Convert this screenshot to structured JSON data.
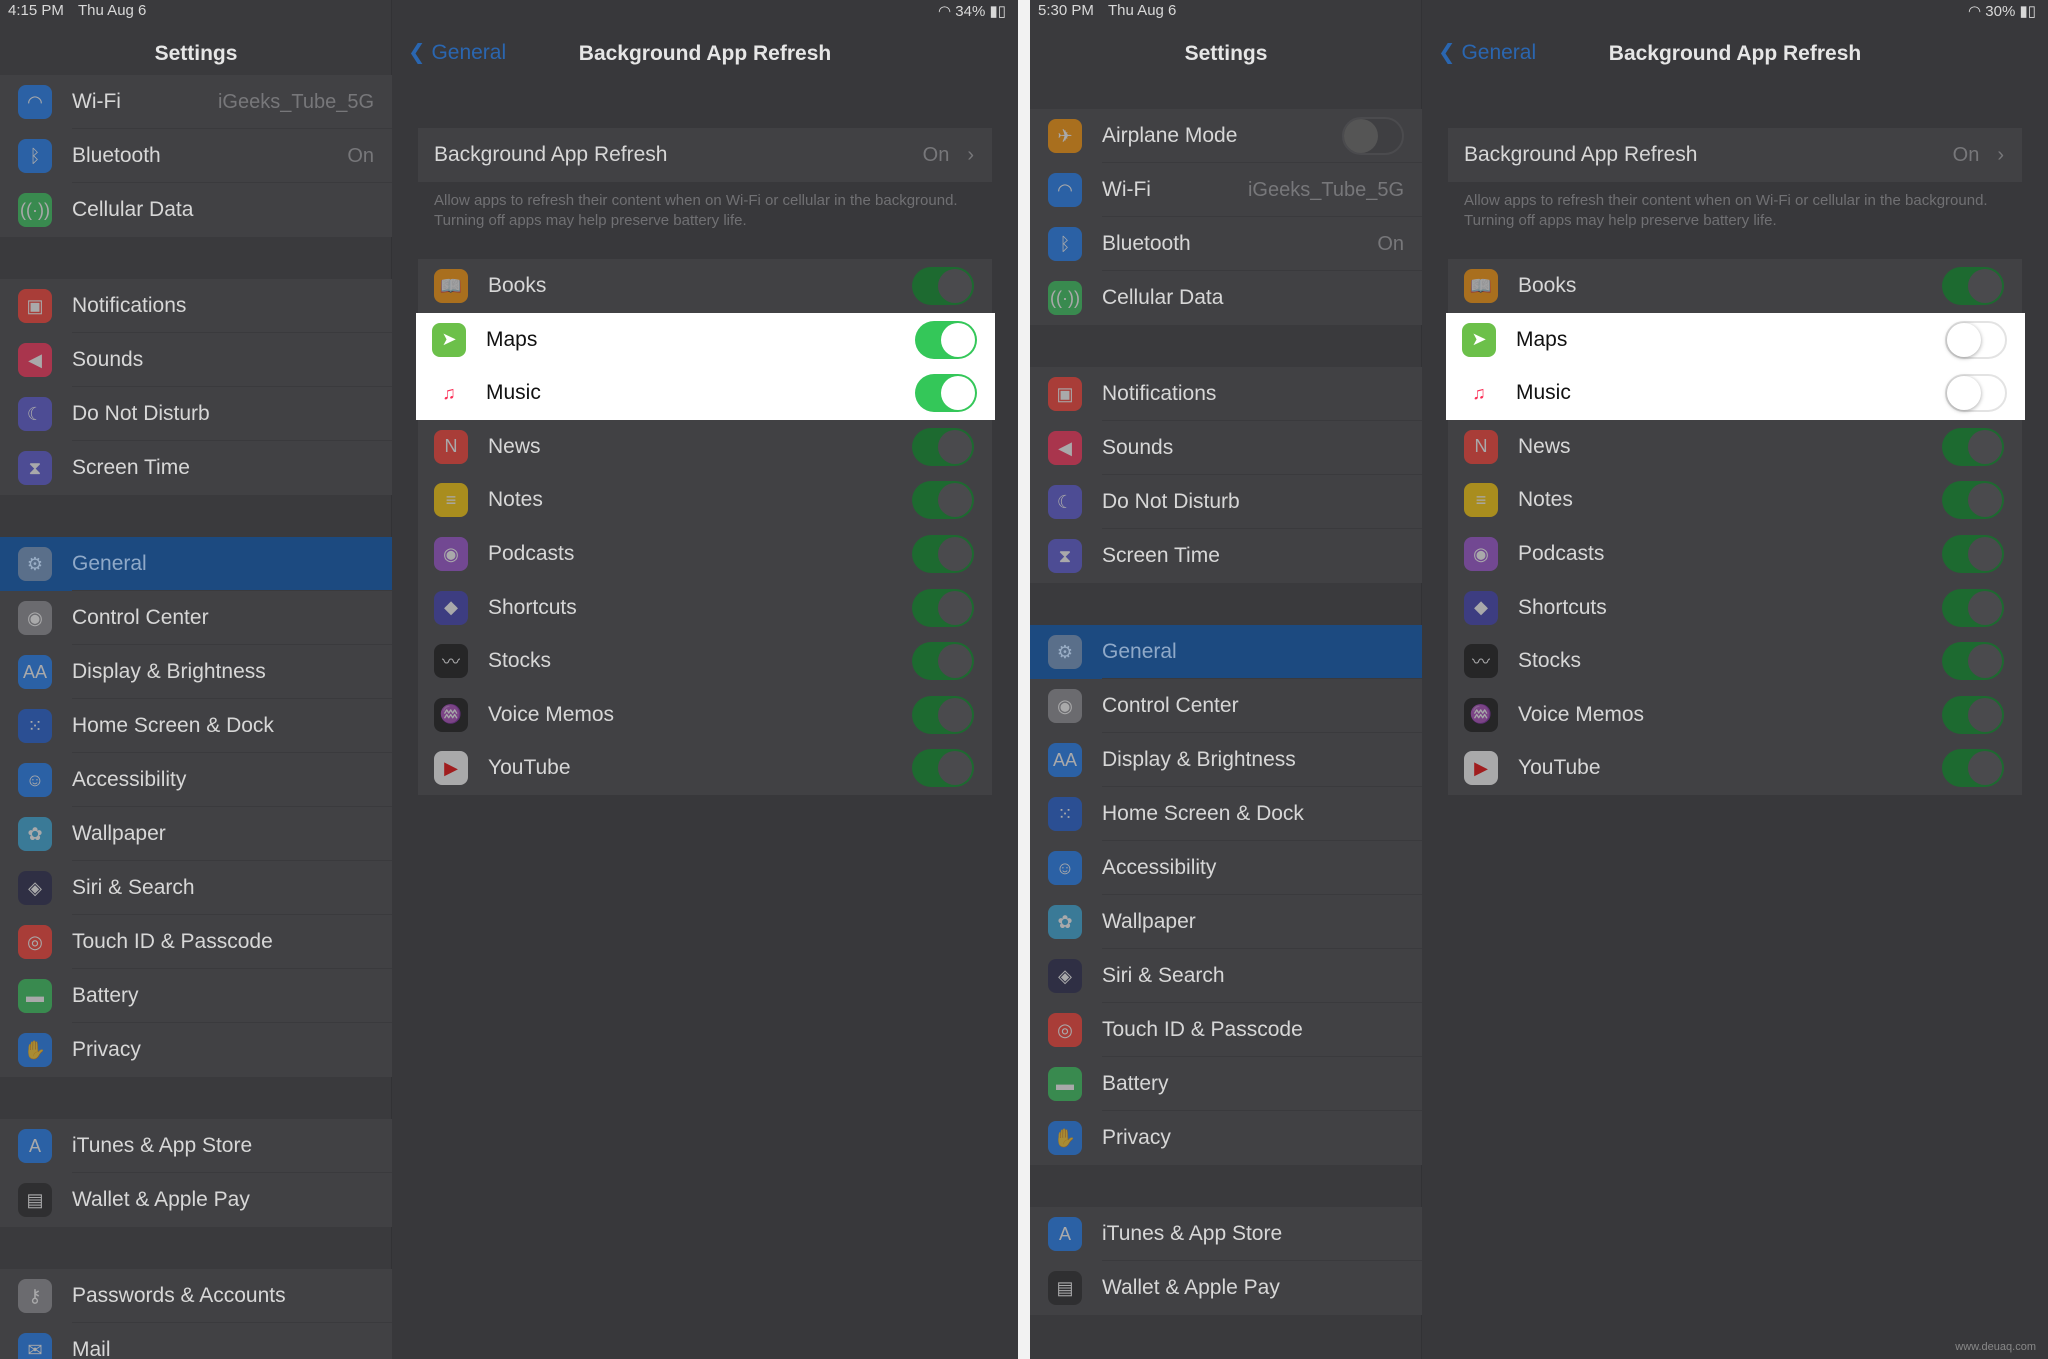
{
  "screens": [
    {
      "status": {
        "time": "4:15 PM",
        "date": "Thu Aug 6",
        "battery": "34%"
      },
      "sidebar": {
        "title": "Settings",
        "selected": "General",
        "groups": [
          [
            {
              "label": "Wi-Fi",
              "value": "iGeeks_Tube_5G",
              "icon": "wifi-icon",
              "color": "#1a7cf5",
              "glyph": "◠"
            },
            {
              "label": "Bluetooth",
              "value": "On",
              "icon": "bluetooth-icon",
              "color": "#1a7cf5",
              "glyph": "ᛒ"
            },
            {
              "label": "Cellular Data",
              "icon": "cellular-icon",
              "color": "#34c759",
              "glyph": "((·))"
            }
          ],
          [
            {
              "label": "Notifications",
              "icon": "notifications-icon",
              "color": "#ff3b30",
              "glyph": "▣"
            },
            {
              "label": "Sounds",
              "icon": "sounds-icon",
              "color": "#ff2d55",
              "glyph": "◀"
            },
            {
              "label": "Do Not Disturb",
              "icon": "moon-icon",
              "color": "#5856d6",
              "glyph": "☾"
            },
            {
              "label": "Screen Time",
              "icon": "hourglass-icon",
              "color": "#5856d6",
              "glyph": "⧗"
            }
          ],
          [
            {
              "label": "General",
              "icon": "gear-icon",
              "color": "#8e8e93",
              "glyph": "⚙"
            },
            {
              "label": "Control Center",
              "icon": "control-center-icon",
              "color": "#8e8e93",
              "glyph": "◉"
            },
            {
              "label": "Display & Brightness",
              "icon": "display-icon",
              "color": "#1a7cf5",
              "glyph": "AA"
            },
            {
              "label": "Home Screen & Dock",
              "icon": "home-screen-icon",
              "color": "#1a5cd5",
              "glyph": "⁙"
            },
            {
              "label": "Accessibility",
              "icon": "accessibility-icon",
              "color": "#1a7cf5",
              "glyph": "☺"
            },
            {
              "label": "Wallpaper",
              "icon": "wallpaper-icon",
              "color": "#35aadc",
              "glyph": "✿"
            },
            {
              "label": "Siri & Search",
              "icon": "siri-icon",
              "color": "#222244",
              "glyph": "◈"
            },
            {
              "label": "Touch ID & Passcode",
              "icon": "fingerprint-icon",
              "color": "#ff3b30",
              "glyph": "◎"
            },
            {
              "label": "Battery",
              "icon": "battery-icon",
              "color": "#34c759",
              "glyph": "▬"
            },
            {
              "label": "Privacy",
              "icon": "hand-icon",
              "color": "#1a7cf5",
              "glyph": "✋"
            }
          ],
          [
            {
              "label": "iTunes & App Store",
              "icon": "app-store-icon",
              "color": "#1a7cf5",
              "glyph": "A"
            },
            {
              "label": "Wallet & Apple Pay",
              "icon": "wallet-icon",
              "color": "#222",
              "glyph": "▤"
            }
          ],
          [
            {
              "label": "Passwords & Accounts",
              "icon": "key-icon",
              "color": "#8e8e93",
              "glyph": "⚷"
            },
            {
              "label": "Mail",
              "icon": "mail-icon",
              "color": "#1a7cf5",
              "glyph": "✉"
            }
          ]
        ]
      },
      "detail": {
        "back": "General",
        "title": "Background App Refresh",
        "main": {
          "label": "Background App Refresh",
          "value": "On"
        },
        "description": "Allow apps to refresh their content when on Wi-Fi or cellular in the background. Turning off apps may help preserve battery life.",
        "apps": [
          {
            "label": "Books",
            "on": true,
            "icon": "books-icon",
            "color": "#ff9500",
            "glyph": "📖"
          },
          {
            "label": "Maps",
            "on": true,
            "highlight": true,
            "icon": "maps-icon",
            "color": "#6cc04a",
            "glyph": "➤"
          },
          {
            "label": "Music",
            "on": true,
            "highlight": true,
            "icon": "music-icon",
            "color": "#ffffff",
            "glyph": "♫"
          },
          {
            "label": "News",
            "on": true,
            "icon": "news-icon",
            "color": "#ff3b30",
            "glyph": "N"
          },
          {
            "label": "Notes",
            "on": true,
            "icon": "notes-icon",
            "color": "#ffcc00",
            "glyph": "≡"
          },
          {
            "label": "Podcasts",
            "on": true,
            "icon": "podcasts-icon",
            "color": "#9b4fd3",
            "glyph": "◉"
          },
          {
            "label": "Shortcuts",
            "on": true,
            "icon": "shortcuts-icon",
            "color": "#3b3bb3",
            "glyph": "◆"
          },
          {
            "label": "Stocks",
            "on": true,
            "icon": "stocks-icon",
            "color": "#111",
            "glyph": "〰"
          },
          {
            "label": "Voice Memos",
            "on": true,
            "icon": "voice-memos-icon",
            "color": "#111",
            "glyph": "♒"
          },
          {
            "label": "YouTube",
            "on": true,
            "icon": "youtube-icon",
            "color": "#ffffff",
            "glyph": "▶"
          }
        ]
      }
    },
    {
      "status": {
        "time": "5:30 PM",
        "date": "Thu Aug 6",
        "battery": "30%"
      },
      "sidebar": {
        "title": "Settings",
        "selected": "General",
        "groups": [
          [
            {
              "label": "Airplane Mode",
              "toggle": false,
              "icon": "airplane-icon",
              "color": "#ff9500",
              "glyph": "✈"
            },
            {
              "label": "Wi-Fi",
              "value": "iGeeks_Tube_5G",
              "icon": "wifi-icon",
              "color": "#1a7cf5",
              "glyph": "◠"
            },
            {
              "label": "Bluetooth",
              "value": "On",
              "icon": "bluetooth-icon",
              "color": "#1a7cf5",
              "glyph": "ᛒ"
            },
            {
              "label": "Cellular Data",
              "icon": "cellular-icon",
              "color": "#34c759",
              "glyph": "((·))"
            }
          ],
          [
            {
              "label": "Notifications",
              "icon": "notifications-icon",
              "color": "#ff3b30",
              "glyph": "▣"
            },
            {
              "label": "Sounds",
              "icon": "sounds-icon",
              "color": "#ff2d55",
              "glyph": "◀"
            },
            {
              "label": "Do Not Disturb",
              "icon": "moon-icon",
              "color": "#5856d6",
              "glyph": "☾"
            },
            {
              "label": "Screen Time",
              "icon": "hourglass-icon",
              "color": "#5856d6",
              "glyph": "⧗"
            }
          ],
          [
            {
              "label": "General",
              "icon": "gear-icon",
              "color": "#8e8e93",
              "glyph": "⚙"
            },
            {
              "label": "Control Center",
              "icon": "control-center-icon",
              "color": "#8e8e93",
              "glyph": "◉"
            },
            {
              "label": "Display & Brightness",
              "icon": "display-icon",
              "color": "#1a7cf5",
              "glyph": "AA"
            },
            {
              "label": "Home Screen & Dock",
              "icon": "home-screen-icon",
              "color": "#1a5cd5",
              "glyph": "⁙"
            },
            {
              "label": "Accessibility",
              "icon": "accessibility-icon",
              "color": "#1a7cf5",
              "glyph": "☺"
            },
            {
              "label": "Wallpaper",
              "icon": "wallpaper-icon",
              "color": "#35aadc",
              "glyph": "✿"
            },
            {
              "label": "Siri & Search",
              "icon": "siri-icon",
              "color": "#222244",
              "glyph": "◈"
            },
            {
              "label": "Touch ID & Passcode",
              "icon": "fingerprint-icon",
              "color": "#ff3b30",
              "glyph": "◎"
            },
            {
              "label": "Battery",
              "icon": "battery-icon",
              "color": "#34c759",
              "glyph": "▬"
            },
            {
              "label": "Privacy",
              "icon": "hand-icon",
              "color": "#1a7cf5",
              "glyph": "✋"
            }
          ],
          [
            {
              "label": "iTunes & App Store",
              "icon": "app-store-icon",
              "color": "#1a7cf5",
              "glyph": "A"
            },
            {
              "label": "Wallet & Apple Pay",
              "icon": "wallet-icon",
              "color": "#222",
              "glyph": "▤"
            }
          ]
        ]
      },
      "detail": {
        "back": "General",
        "title": "Background App Refresh",
        "main": {
          "label": "Background App Refresh",
          "value": "On"
        },
        "description": "Allow apps to refresh their content when on Wi-Fi or cellular in the background. Turning off apps may help preserve battery life.",
        "apps": [
          {
            "label": "Books",
            "on": true,
            "icon": "books-icon",
            "color": "#ff9500",
            "glyph": "📖"
          },
          {
            "label": "Maps",
            "on": false,
            "highlight": true,
            "icon": "maps-icon",
            "color": "#6cc04a",
            "glyph": "➤"
          },
          {
            "label": "Music",
            "on": false,
            "highlight": true,
            "icon": "music-icon",
            "color": "#ffffff",
            "glyph": "♫"
          },
          {
            "label": "News",
            "on": true,
            "icon": "news-icon",
            "color": "#ff3b30",
            "glyph": "N"
          },
          {
            "label": "Notes",
            "on": true,
            "icon": "notes-icon",
            "color": "#ffcc00",
            "glyph": "≡"
          },
          {
            "label": "Podcasts",
            "on": true,
            "icon": "podcasts-icon",
            "color": "#9b4fd3",
            "glyph": "◉"
          },
          {
            "label": "Shortcuts",
            "on": true,
            "icon": "shortcuts-icon",
            "color": "#3b3bb3",
            "glyph": "◆"
          },
          {
            "label": "Stocks",
            "on": true,
            "icon": "stocks-icon",
            "color": "#111",
            "glyph": "〰"
          },
          {
            "label": "Voice Memos",
            "on": true,
            "icon": "voice-memos-icon",
            "color": "#111",
            "glyph": "♒"
          },
          {
            "label": "YouTube",
            "on": true,
            "icon": "youtube-icon",
            "color": "#ffffff",
            "glyph": "▶"
          }
        ]
      }
    }
  ],
  "watermark": "www.deuaq.com",
  "colors": {
    "toggle_on": "#34c759",
    "selected_row": "#1c4a80",
    "link": "#2a66b0"
  }
}
